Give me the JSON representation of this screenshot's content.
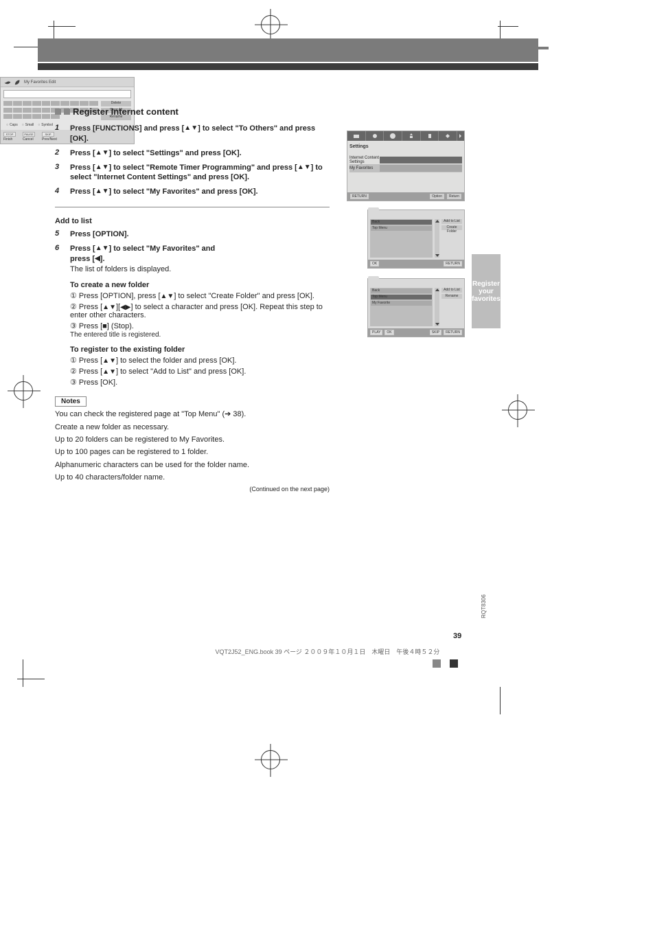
{
  "domain": "Document",
  "side_tab": [
    "Register",
    "your",
    "favorites"
  ],
  "section_title": "Register Internet content",
  "glyphs": {
    "up": "▲",
    "down": "▼",
    "left": "◀",
    "right": "▶"
  },
  "steps_a": [
    {
      "n": "1",
      "pre": "Press ",
      "btn": "FUNCTIONS",
      "post": " and press [",
      "g": "ud",
      "post2": "] to select \"To Others\" and press [OK]."
    },
    {
      "n": "2",
      "pre": "Press [",
      "g": "ud",
      "post": "] to select \"Settings\" and press [OK]."
    },
    {
      "n": "3",
      "pre": "Press [",
      "g": "ud",
      "post": "] to select \"Remote Timer Programming\" and press [",
      "g2": "ud",
      "post2": "] to select \"Internet Content Settings\" and press [OK]."
    },
    {
      "n": "4",
      "pre": "Press [",
      "g": "ud",
      "post": "] to select \"My Favorites\" and press [OK]."
    }
  ],
  "continued_label": "(Continued on the next page)",
  "hr": true,
  "add_title": "Add to list",
  "step5": {
    "n": "5",
    "pre": "Press [OPTION]."
  },
  "step6": {
    "n": "6",
    "pre": "Press [",
    "g": "ud",
    "post": "] to select \"My Favorites\" and "
  },
  "step6b": {
    "pre": "press [",
    "g": "l",
    "post": "]."
  },
  "step6c": "The list of folders is displayed.",
  "new_folder_title": "To create a new folder",
  "nf_1": {
    "pre": "① Press [OPTION], press [",
    "g": "ud",
    "post": "] to select \"Create Folder\" and press [OK]."
  },
  "nf_2": {
    "pre": "② Press [",
    "g": "ud",
    "post": "][",
    "g2": "lr",
    "post2": "] to select a character and press [OK]. Repeat this step to enter other characters."
  },
  "nf_3": "③ Press [■] (Stop).",
  "nf_note": "    The entered title is registered.",
  "exist_title": "To register to the existing folder",
  "ex_1": {
    "pre": "① Press [",
    "g": "ud",
    "post": "] to select the folder and press [OK]."
  },
  "ex_2": {
    "pre": "② Press [",
    "g": "ud",
    "post": "] to select \"Add to List\" and press [OK]."
  },
  "ex_3": "③ Press [OK].",
  "notes_title": "Notes",
  "notes": [
    "You can check the registered page at \"Top Menu\" (➔ 38).",
    "Create a new folder as necessary.",
    "Up to 20 folders can be registered to My Favorites.",
    "Up to 100 pages can be registered to 1 folder.",
    "Alphanumeric characters can be used for the folder name.",
    "Up to 40 characters/folder name."
  ],
  "settings_ui": {
    "tab_label": "Settings",
    "item1": "Internet Content Settings",
    "item2": "My Favorites",
    "foot": {
      "back": "RETURN",
      "btn1": "Option",
      "btn2": "Return"
    }
  },
  "folder_ui_a": {
    "rows": [
      "Back",
      "Top Menu"
    ],
    "side": [
      "Add to List",
      "Create Folder"
    ],
    "foot": [
      "OK",
      "RETURN"
    ]
  },
  "folder_ui_b": {
    "rows": [
      "Back",
      "Top Menu",
      "My Favorite"
    ],
    "side": [
      "Add to List",
      "Rename"
    ],
    "foot": [
      "PLAY",
      "OK",
      "SKIP",
      "RETURN"
    ]
  },
  "key_ui": {
    "title": "My Favorites Edit",
    "input": "",
    "side": [
      "Delete",
      "Clear All",
      "Rename"
    ],
    "legend": [
      "Caps",
      "Small",
      "Symbol"
    ],
    "foot": [
      {
        "box": "STOP",
        "label": "Finish"
      },
      {
        "box": "PAUSE",
        "label": "Cancel"
      },
      {
        "box": "SKIP",
        "label": "Prev/Next"
      }
    ]
  },
  "footer": {
    "filename": "VQT2J52_ENG.book  39 ページ  ２００９年１０月１日　木曜日　午後４時５２分",
    "page": "39",
    "rqt": "RQT8306"
  }
}
